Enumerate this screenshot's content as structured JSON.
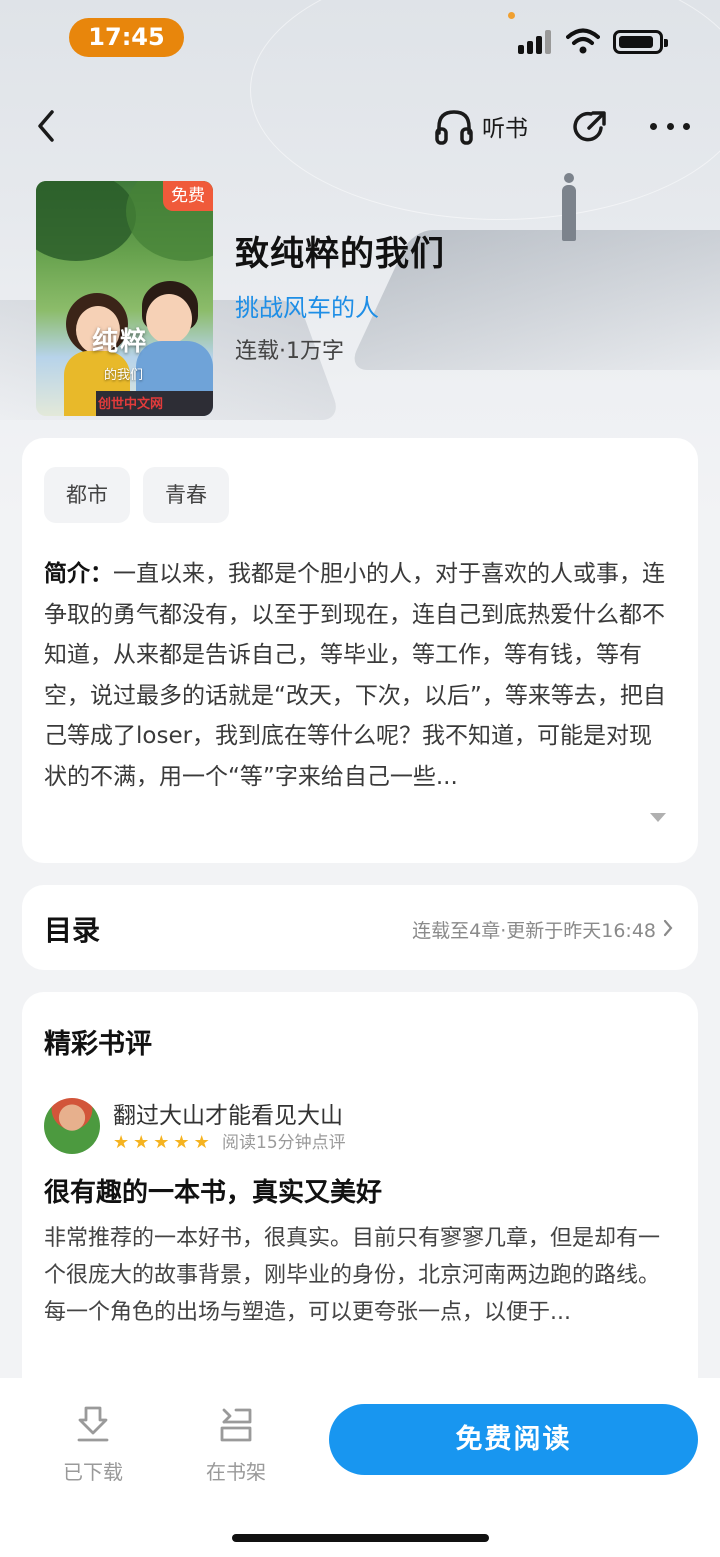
{
  "status_bar": {
    "time": "17:45"
  },
  "nav": {
    "listen_label": "听书"
  },
  "book": {
    "free_badge": "免费",
    "cover_title": "纯粹",
    "cover_subtitle": "的我们",
    "cover_brand": "创世中文网",
    "title": "致纯粹的我们",
    "author": "挑战风车的人",
    "meta": "连载·1万字"
  },
  "tags": [
    "都市",
    "青春"
  ],
  "intro": {
    "label": "简介：",
    "text": "一直以来，我都是个胆小的人，对于喜欢的人或事，连争取的勇气都没有，以至于到现在，连自己到底热爱什么都不知道，从来都是告诉自己，等毕业，等工作，等有钱，等有空，说过最多的话就是“改天，下次，以后”，等来等去，把自己等成了loser，我到底在等什么呢？我不知道，可能是对现状的不满，用一个“等”字来给自己一些..."
  },
  "toc": {
    "title": "目录",
    "info": "连载至4章·更新于昨天16:48"
  },
  "reviews": {
    "heading": "精彩书评",
    "items": [
      {
        "user": "翻过大山才能看见大山",
        "rating": 5,
        "note": "阅读15分钟点评",
        "title": "很有趣的一本书，真实又美好",
        "text": "非常推荐的一本好书，很真实。目前只有寥寥几章，但是却有一个很庞大的故事背景，刚毕业的身份，北京河南两边跑的路线。\n每一个角色的出场与塑造，可以更夸张一点，以便于..."
      }
    ]
  },
  "bottom_bar": {
    "downloaded_label": "已下载",
    "bookshelf_label": "在书架",
    "read_button": "免费阅读"
  },
  "colors": {
    "accent": "#1896f0",
    "author": "#1e8ee6",
    "badge": "#f05a3a",
    "time_pill": "#e8860c",
    "star": "#f5b320"
  }
}
